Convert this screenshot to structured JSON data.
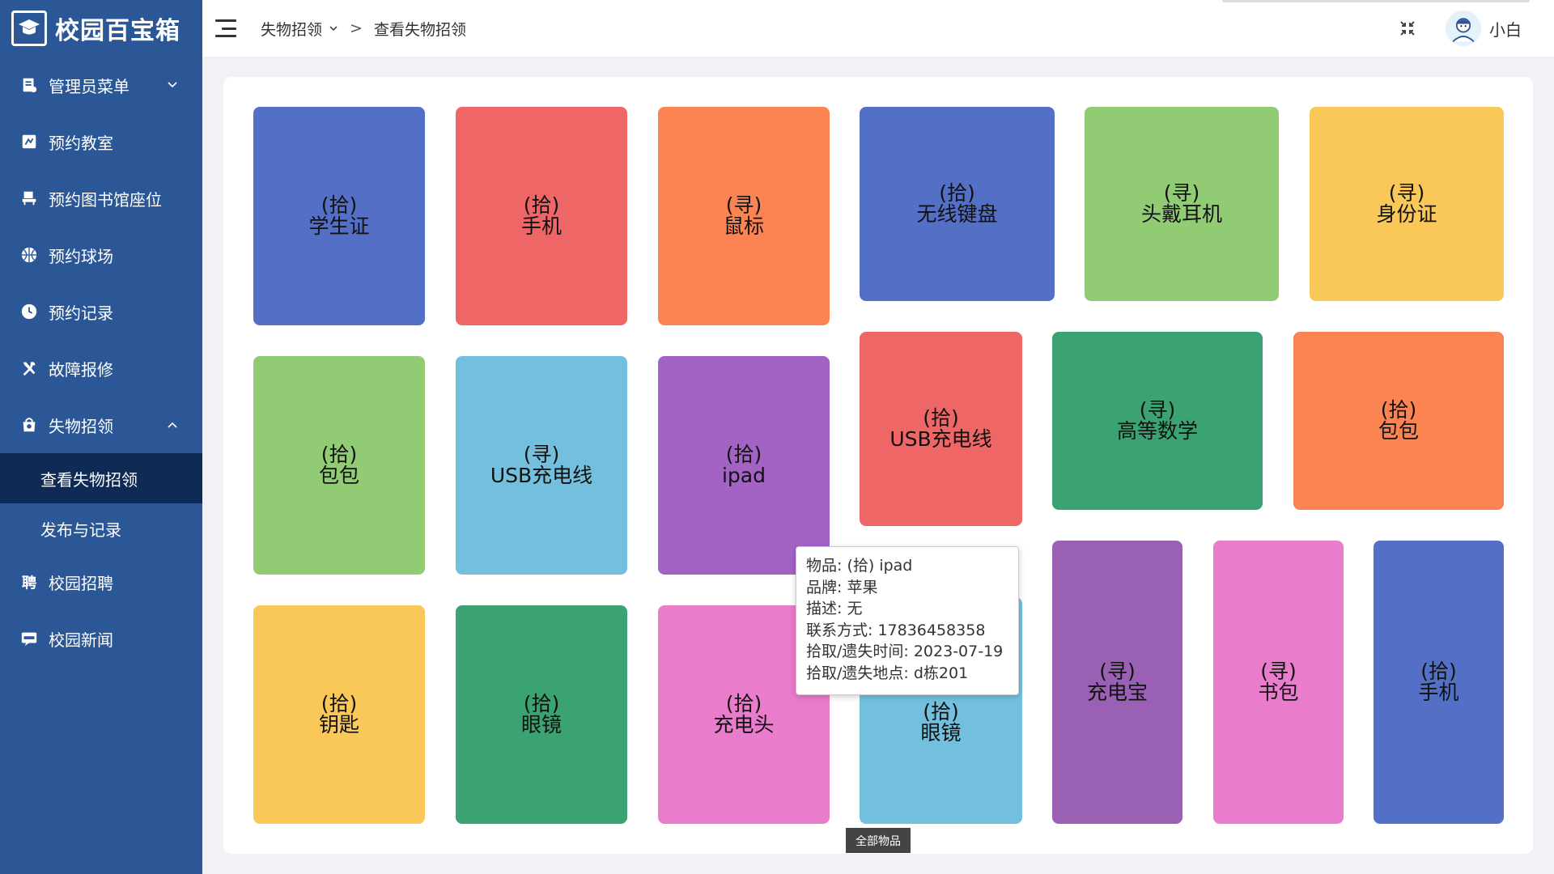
{
  "app": {
    "title": "校园百宝箱"
  },
  "sidebar": {
    "items": [
      {
        "label": "管理员菜单",
        "icon": "admin-menu-icon",
        "expandable": true,
        "expanded": false
      },
      {
        "label": "预约教室",
        "icon": "classroom-icon"
      },
      {
        "label": "预约图书馆座位",
        "icon": "library-seat-icon"
      },
      {
        "label": "预约球场",
        "icon": "basketball-icon"
      },
      {
        "label": "预约记录",
        "icon": "clock-icon"
      },
      {
        "label": "故障报修",
        "icon": "tools-icon"
      },
      {
        "label": "失物招领",
        "icon": "lost-found-icon",
        "expandable": true,
        "expanded": true
      }
    ],
    "sub_items": [
      {
        "label": "查看失物招领",
        "active": true
      },
      {
        "label": "发布与记录",
        "active": false
      }
    ],
    "bottom_items": [
      {
        "label": "校园招聘",
        "icon": "recruit-icon"
      },
      {
        "label": "校园新闻",
        "icon": "news-icon"
      }
    ]
  },
  "header": {
    "breadcrumb_parent": "失物招领",
    "breadcrumb_current": "查看失物招领",
    "user_name": "小白"
  },
  "colors": {
    "sidebar_bg": "#2b5797",
    "sidebar_active": "#0f2a55",
    "blue": "#5470c6",
    "red": "#ee6666",
    "orange": "#fc8452",
    "green": "#91cc75",
    "yellow": "#fac858",
    "cyan": "#73c0de",
    "purple": "#a363c4",
    "darkgreen": "#3ba272",
    "pink": "#ea7ccc",
    "violet": "#9a60b4"
  },
  "items": [
    {
      "tag": "(拾)",
      "name": "学生证",
      "color": "#5470c6"
    },
    {
      "tag": "(拾)",
      "name": "手机",
      "color": "#ee6666"
    },
    {
      "tag": "(寻)",
      "name": "鼠标",
      "color": "#fc8452"
    },
    {
      "tag": "(拾)",
      "name": "无线键盘",
      "color": "#5470c6"
    },
    {
      "tag": "(寻)",
      "name": "头戴耳机",
      "color": "#91cc75"
    },
    {
      "tag": "(寻)",
      "name": "身份证",
      "color": "#fac858"
    },
    {
      "tag": "(拾)",
      "name": "包包",
      "color": "#91cc75"
    },
    {
      "tag": "(寻)",
      "name": "USB充电线",
      "color": "#73c0de"
    },
    {
      "tag": "(拾)",
      "name": "ipad",
      "color": "#a363c4"
    },
    {
      "tag": "(拾)",
      "name": "USB充电线",
      "color": "#ee6666"
    },
    {
      "tag": "(寻)",
      "name": "高等数学",
      "color": "#3ba272"
    },
    {
      "tag": "(拾)",
      "name": "包包",
      "color": "#fc8452"
    },
    {
      "tag": "(拾)",
      "name": "钥匙",
      "color": "#fac858"
    },
    {
      "tag": "(拾)",
      "name": "眼镜",
      "color": "#3ba272"
    },
    {
      "tag": "(拾)",
      "name": "充电头",
      "color": "#ea7ccc"
    },
    {
      "tag": "(拾)",
      "name": "眼镜",
      "color": "#73c0de"
    },
    {
      "tag": "(寻)",
      "name": "充电宝",
      "color": "#9a60b4"
    },
    {
      "tag": "(寻)",
      "name": "书包",
      "color": "#ea7ccc"
    },
    {
      "tag": "(拾)",
      "name": "手机",
      "color": "#5470c6"
    }
  ],
  "tooltip": {
    "line1": "物品: (拾) ipad",
    "line2": "品牌: 苹果",
    "line3": "描述: 无",
    "line4": "联系方式: 17836458358",
    "line5": "拾取/遗失时间: 2023-07-19",
    "line6": "拾取/遗失地点: d栋201"
  },
  "footer_label": "全部物品"
}
